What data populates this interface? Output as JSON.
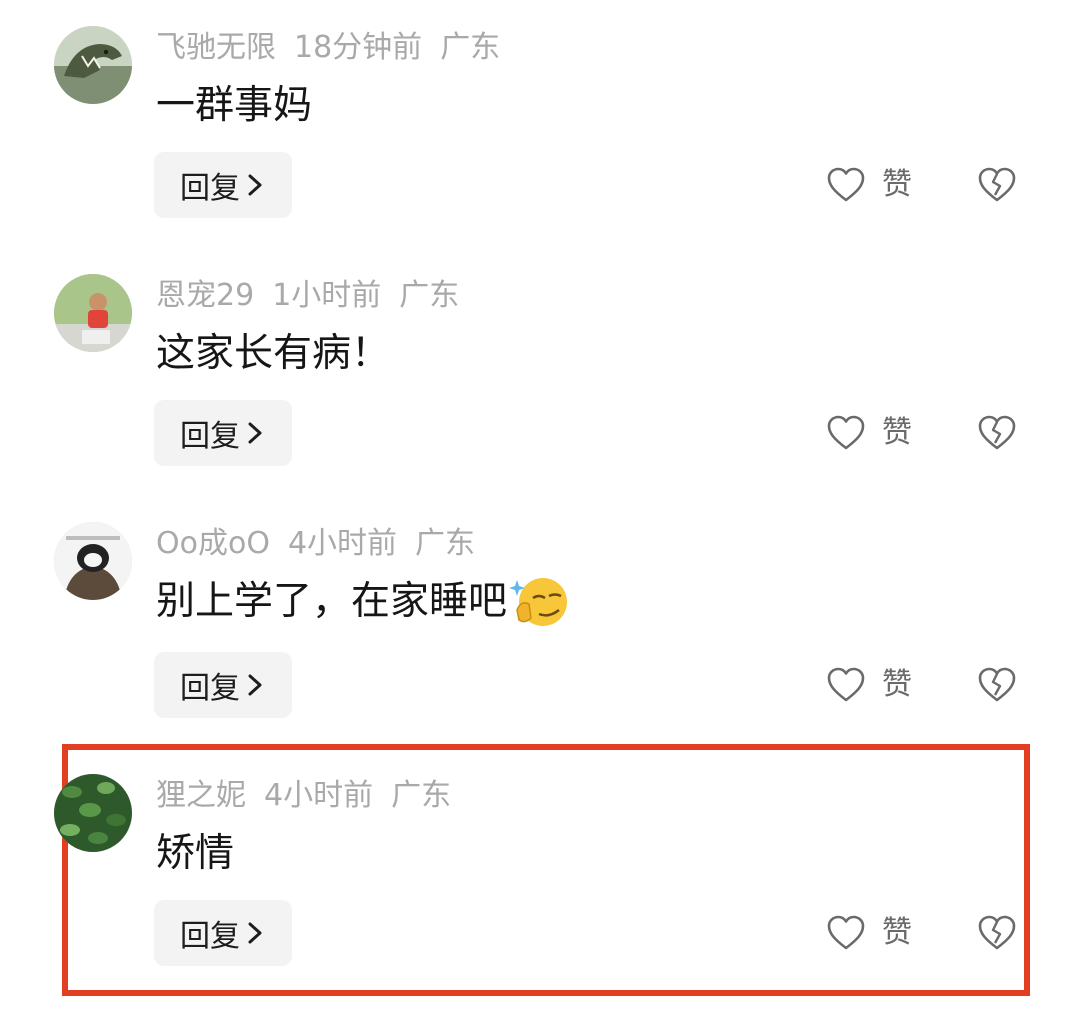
{
  "comments": [
    {
      "username": "飞驰无限",
      "time": "18分钟前",
      "location": "广东",
      "text": "一群事妈",
      "emoji": "",
      "reply_label": "回复",
      "like_label": "赞",
      "avatar": "dinosaur-avatar"
    },
    {
      "username": "恩宠29",
      "time": "1小时前",
      "location": "广东",
      "text": "这家长有病！",
      "emoji": "",
      "reply_label": "回复",
      "like_label": "赞",
      "avatar": "child-photo-avatar"
    },
    {
      "username": "Oo成oO",
      "time": "4小时前",
      "location": "广东",
      "text": "别上学了，在家睡吧",
      "emoji": "smirk-emoji",
      "reply_label": "回复",
      "like_label": "赞",
      "avatar": "cartoon-avatar"
    },
    {
      "username": "狸之妮",
      "time": "4小时前",
      "location": "广东",
      "text": "矫情",
      "emoji": "",
      "reply_label": "回复",
      "like_label": "赞",
      "avatar": "leaves-avatar"
    }
  ],
  "colors": {
    "highlight_border": "#e23f22",
    "meta_text": "#a9a9a9",
    "body_text": "#161616",
    "reply_bg": "#f3f3f3"
  },
  "icons": {
    "like": "heart-outline-icon",
    "dislike": "broken-heart-icon",
    "reply_chevron": "chevron-right-icon"
  }
}
